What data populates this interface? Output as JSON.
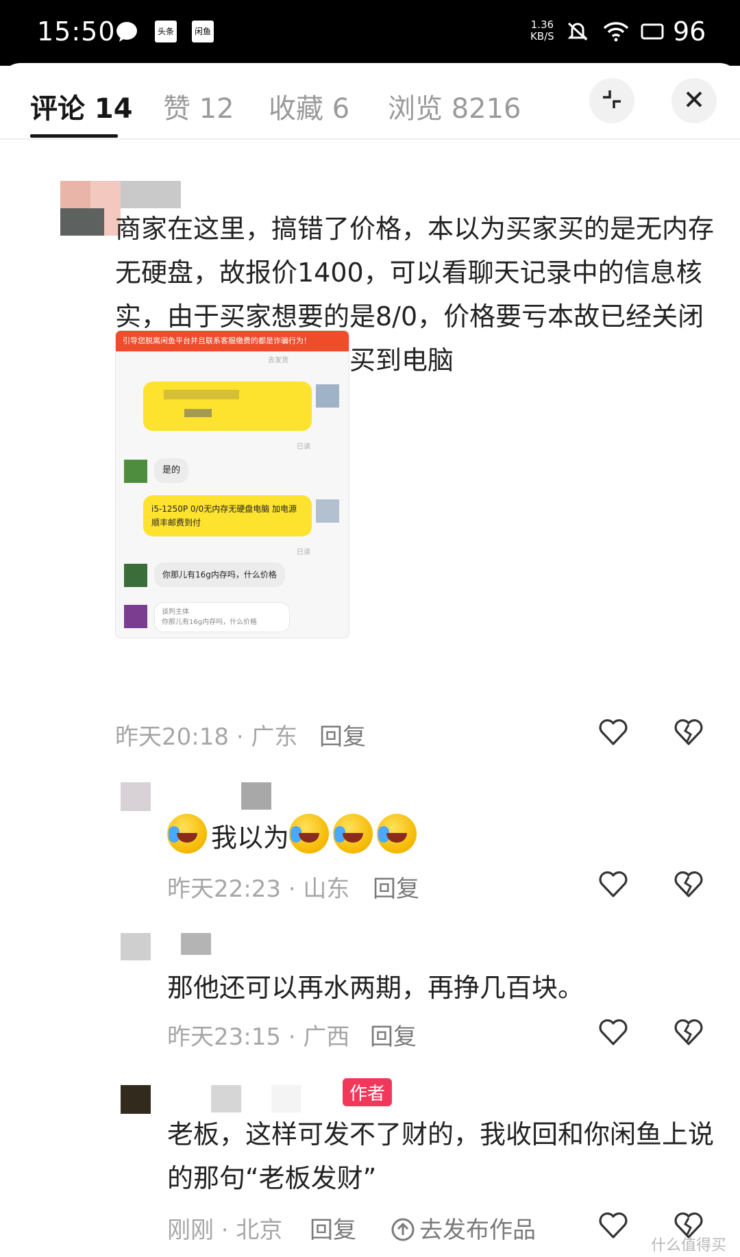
{
  "status_bar": {
    "time": "15:50",
    "app_icons": [
      "头条",
      "闲鱼"
    ],
    "net_speed_value": "1.36",
    "net_speed_unit": "KB/S",
    "battery": "96"
  },
  "tabs": [
    {
      "label": "评论 14",
      "active": true
    },
    {
      "label": "赞 12",
      "active": false
    },
    {
      "label": "收藏 6",
      "active": false
    },
    {
      "label": "浏览 8216",
      "active": false
    }
  ],
  "header_buttons": {
    "collapse_icon": "collapse-icon",
    "close_icon": "close-icon"
  },
  "comments": [
    {
      "text": "商家在这里，搞错了价格，本以为买家买的是无内存无硬盘，故报价1400，可以看聊天记录中的信息核实，由于买家想要的是8/0，价格要亏本故已经关闭交易。买家实际并未买到电脑",
      "time_location": "昨天20:18 · 广东",
      "reply_label": "回复",
      "image": {
        "warning": "引导您脱离闲鱼平台并且联系客服缴费的都是诈骗行为！",
        "top_label": "去发货",
        "read_1": "已读",
        "reply_1": "是的",
        "bubble_2": "i5-1250P  0/0无内存无硬盘电脑 加电源顺丰邮费到付",
        "read_2": "已读",
        "question": "你那儿有16g内存吗，什么价格",
        "quote_title": "谈判主体",
        "quote_text": "你那儿有16g内存吗，什么价格"
      }
    },
    {
      "text": "我以为",
      "time_location": "昨天22:23 · 山东",
      "reply_label": "回复"
    },
    {
      "text": "那他还可以再水两期，再挣几百块。",
      "time_location": "昨天23:15 · 广西",
      "reply_label": "回复"
    },
    {
      "badge": "作者",
      "text": "老板，这样可发不了财的，我收回和你闲鱼上说的那句“老板发财”",
      "time_location": "刚刚 · 北京",
      "reply_label": "回复",
      "publish_label": "去发布作品"
    }
  ],
  "watermark": "什么值得买",
  "colors": {
    "accent_badge": "#f2385a",
    "tab_active": "#161616",
    "tab_inactive": "#9a9a9a",
    "chat_bubble": "#fde22e",
    "warning_bar": "#ef4c2a"
  }
}
